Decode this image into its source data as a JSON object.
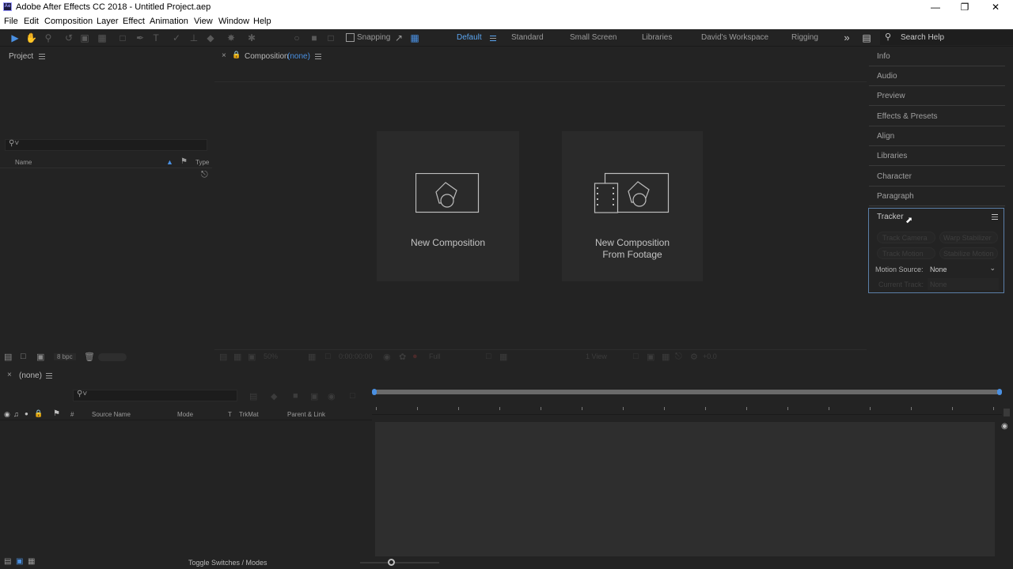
{
  "window": {
    "title": "Adobe After Effects CC 2018 - Untitled Project.aep",
    "app_icon": "Ae"
  },
  "menu": [
    "File",
    "Edit",
    "Composition",
    "Layer",
    "Effect",
    "Animation",
    "View",
    "Window",
    "Help"
  ],
  "toolbar": {
    "snapping_label": "Snapping",
    "workspaces": [
      "Default",
      "Standard",
      "Small Screen",
      "Libraries",
      "David's Workspace",
      "Rigging"
    ],
    "active_workspace": "Default",
    "search_placeholder": "Search Help"
  },
  "project": {
    "tab_label": "Project",
    "col_name": "Name",
    "col_type": "Type",
    "bpc_label": "8 bpc"
  },
  "composition": {
    "tab_label": "Composition",
    "tab_value": "(none)",
    "new_comp_label": "New Composition",
    "new_comp_footage_line1": "New Composition",
    "new_comp_footage_line2": "From Footage",
    "footer": {
      "zoom": "50%",
      "timecode": "0:00:00:00",
      "resolution": "Full",
      "views": "1 View",
      "exposure": "+0.0"
    }
  },
  "right_panels": [
    "Info",
    "Audio",
    "Preview",
    "Effects & Presets",
    "Align",
    "Libraries",
    "Character",
    "Paragraph"
  ],
  "tracker": {
    "title": "Tracker",
    "track_camera": "Track Camera",
    "warp_stabilizer": "Warp Stabilizer",
    "track_motion": "Track Motion",
    "stabilize_motion": "Stabilize Motion",
    "motion_source_label": "Motion Source:",
    "motion_source_value": "None",
    "current_track_label": "Current Track:",
    "current_track_value": "None"
  },
  "timeline": {
    "tab_label": "(none)",
    "columns": {
      "hash": "#",
      "source_name": "Source Name",
      "mode": "Mode",
      "t": "T",
      "trkmat": "TrkMat",
      "parent": "Parent & Link"
    },
    "footer_label": "Toggle Switches / Modes"
  },
  "colors": {
    "accent": "#4a90e2",
    "panel_bg": "#232323",
    "focus_border": "#5b7fa8"
  }
}
